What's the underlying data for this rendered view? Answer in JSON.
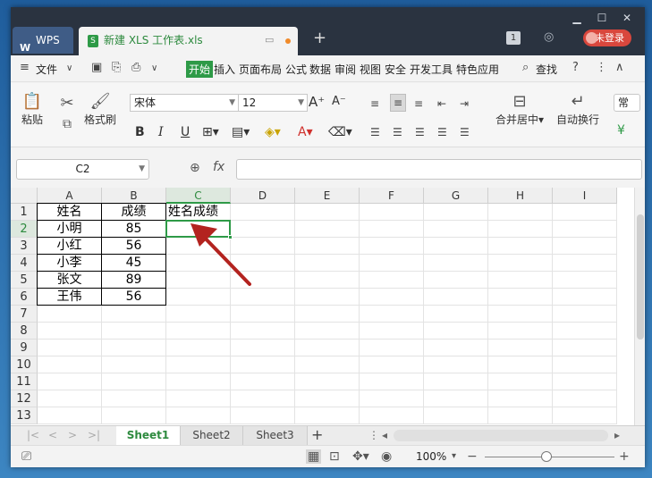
{
  "app": {
    "tab_wps": "WPS",
    "doc_tab": "新建 XLS 工作表.xls",
    "login": "未登录",
    "badge": "1"
  },
  "menu": {
    "file": "文件",
    "items": [
      "开始",
      "插入",
      "页面布局",
      "公式",
      "数据",
      "审阅",
      "视图",
      "安全",
      "开发工具",
      "特色应用"
    ],
    "search": "查找"
  },
  "ribbon": {
    "paste": "粘贴",
    "format_painter": "格式刷",
    "font_name": "宋体",
    "font_size": "12",
    "merge_center": "合并居中",
    "wrap": "自动换行",
    "bold": "B",
    "italic": "I",
    "underline": "U",
    "font_color": "A",
    "general": "常"
  },
  "formula": {
    "name_box": "C2",
    "fx": "fx",
    "value": ""
  },
  "columns": [
    "A",
    "B",
    "C",
    "D",
    "E",
    "F",
    "G",
    "H",
    "I"
  ],
  "rows": [
    "1",
    "2",
    "3",
    "4",
    "5",
    "6",
    "7",
    "8",
    "9",
    "10",
    "11",
    "12",
    "13"
  ],
  "table": {
    "header": [
      "姓名",
      "成绩"
    ],
    "data": [
      [
        "小明",
        "85"
      ],
      [
        "小红",
        "56"
      ],
      [
        "小李",
        "45"
      ],
      [
        "张文",
        "89"
      ],
      [
        "王伟",
        "56"
      ]
    ]
  },
  "c1_text": "姓名成绩",
  "sheets": [
    "Sheet1",
    "Sheet2",
    "Sheet3"
  ],
  "status": {
    "zoom": "100%"
  },
  "colors": {
    "accent": "#2e9a47",
    "arrow": "#b3231f",
    "login": "#d9473d"
  }
}
